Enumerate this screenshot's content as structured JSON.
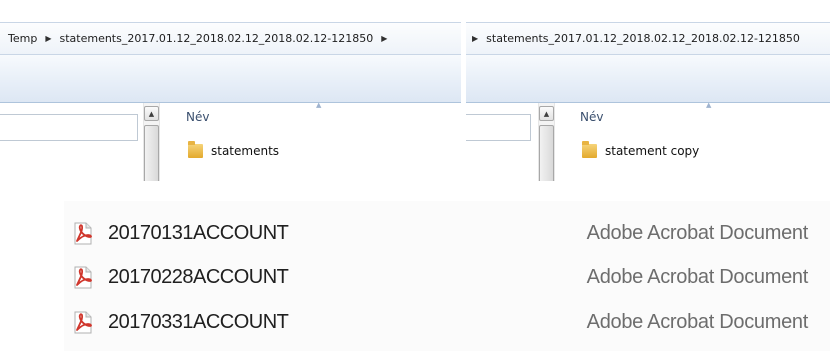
{
  "left_window": {
    "breadcrumbs": [
      "Temp",
      "statements_2017.01.12_2018.02.12_2018.02.12-121850"
    ],
    "column_header": "Név",
    "folder_item": "statements"
  },
  "right_window": {
    "breadcrumbs": [
      "statements_2017.01.12_2018.02.12_2018.02.12-121850"
    ],
    "column_header": "Név",
    "folder_item": "statement copy"
  },
  "file_list": {
    "rows": [
      {
        "name": "20170131ACCOUNT",
        "type": "Adobe Acrobat Document"
      },
      {
        "name": "20170228ACCOUNT",
        "type": "Adobe Acrobat Document"
      },
      {
        "name": "20170331ACCOUNT",
        "type": "Adobe Acrobat Document"
      }
    ]
  },
  "icons": {
    "breadcrumb_separator": "chevron-right-icon",
    "folder": "folder-icon",
    "file": "pdf-icon",
    "sort": "sort-up-icon",
    "scroll": "scroll-up-arrow-icon"
  },
  "colors": {
    "header_text": "#3a4f6e",
    "pdf_red": "#d0362c",
    "folder_yellow": "#e8b443"
  }
}
